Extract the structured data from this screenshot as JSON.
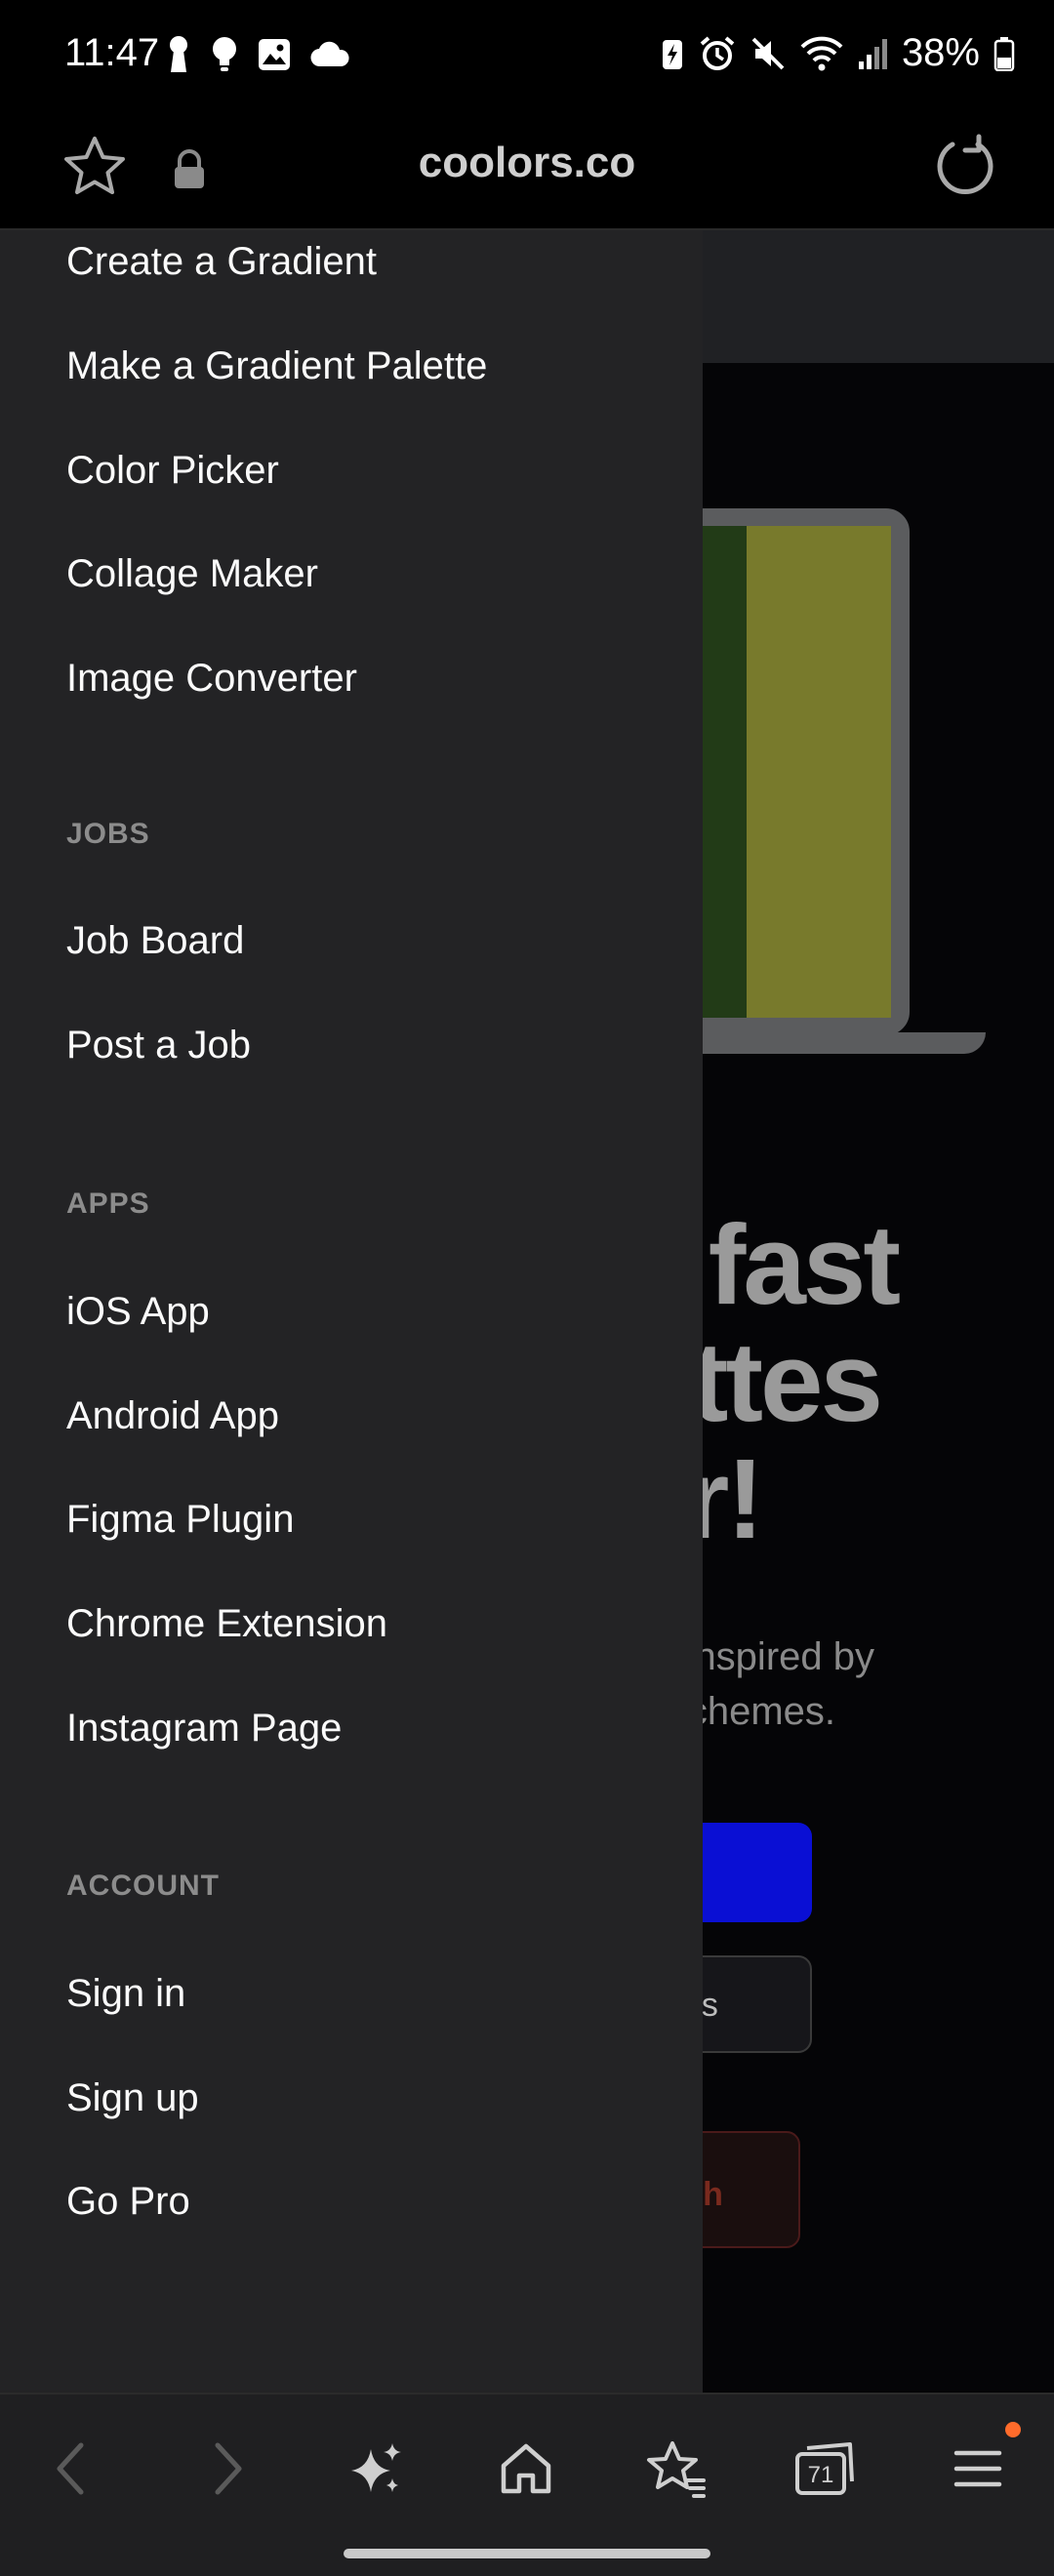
{
  "status_bar": {
    "time": "11:47",
    "battery": "38%"
  },
  "browser": {
    "url": "coolors.co",
    "tabs_count": "71"
  },
  "background_page": {
    "hero_title_lines": [
      "fast",
      "ttes",
      "or!"
    ],
    "hero_sub_lines": [
      "et inspired by",
      "schemes."
    ],
    "secondary_button_fragment": "es",
    "pro_button_fragment": "nth",
    "swatch_colors": [
      "#223b17",
      "#787a2c"
    ]
  },
  "drawer": {
    "tools": [
      "Create a Gradient",
      "Make a Gradient Palette",
      "Color Picker",
      "Collage Maker",
      "Image Converter"
    ],
    "jobs_header": "JOBS",
    "jobs": [
      "Job Board",
      "Post a Job"
    ],
    "apps_header": "APPS",
    "apps": [
      "iOS App",
      "Android App",
      "Figma Plugin",
      "Chrome Extension",
      "Instagram Page"
    ],
    "account_header": "ACCOUNT",
    "account": [
      "Sign in",
      "Sign up",
      "Go Pro"
    ]
  },
  "colors": {
    "drawer_bg": "#232325",
    "accent_blue": "#0a0fd4",
    "notification_dot": "#ff6b2b"
  }
}
